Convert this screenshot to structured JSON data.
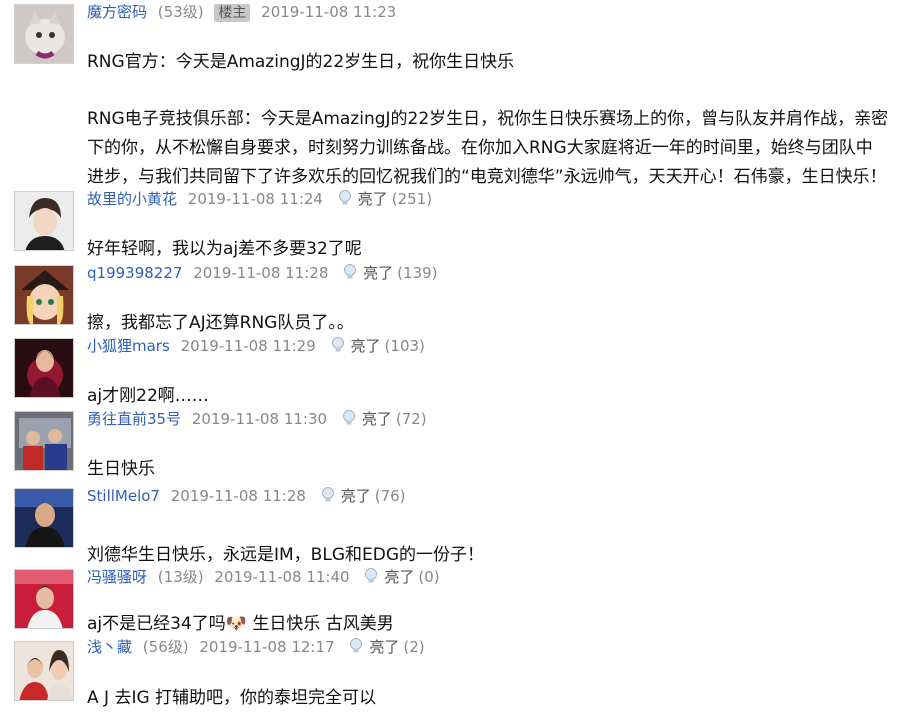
{
  "posts": [
    {
      "user": "魔方密码",
      "level": "(53级)",
      "tag": "楼主",
      "time": "2019-11-08 11:23",
      "lines": [
        "RNG官方：今天是AmazingJ的22岁生日，祝你生日快乐",
        "RNG电子竞技俱乐部：今天是AmazingJ的22岁生日，祝你生日快乐赛场上的你，曾与队友并肩作战，亲密",
        "下的你，从不松懈自身要求，时刻努力训练备战。在你加入RNG大家庭将近一年的时间里，始终与团队中",
        "进步，与我们共同留下了许多欢乐的回忆祝我们的“电竞刘德华”永远帅气，天天开心！石伟豪，生日快乐！"
      ]
    },
    {
      "user": "故里的小黄花",
      "time": "2019-11-08 11:24",
      "like_label": "亮了",
      "like_count": "(251)",
      "text": "好年轻啊，我以为aj差不多要32了呢"
    },
    {
      "user": "q199398227",
      "time": "2019-11-08 11:28",
      "like_label": "亮了",
      "like_count": "(139)",
      "text": "擦，我都忘了AJ还算RNG队员了。。"
    },
    {
      "user": "小狐狸mars",
      "time": "2019-11-08 11:29",
      "like_label": "亮了",
      "like_count": "(103)",
      "text": "aj才刚22啊……"
    },
    {
      "user": "勇往直前35号",
      "time": "2019-11-08 11:30",
      "like_label": "亮了",
      "like_count": "(72)",
      "text": "生日快乐"
    },
    {
      "user": "StillMelo7",
      "time": "2019-11-08 11:28",
      "like_label": "亮了",
      "like_count": "(76)",
      "text": "刘德华生日快乐，永远是IM，BLG和EDG的一份子！"
    },
    {
      "user": "冯骚骚呀",
      "level": "(13级)",
      "time": "2019-11-08 11:40",
      "like_label": "亮了",
      "like_count": "(0)",
      "text": "aj不是已经34了吗🐶  生日快乐 古风美男"
    },
    {
      "user": "浅丶藏",
      "level": "(56级)",
      "time": "2019-11-08 12:17",
      "like_label": "亮了",
      "like_count": "(2)",
      "text": "A J 去IG 打辅助吧，你的泰坦完全可以"
    }
  ],
  "colors": {
    "username": "#2e5fb8",
    "meta": "#888888",
    "tag_bg": "#c8c8c8"
  },
  "icons": {
    "like": "lightbulb-icon"
  }
}
